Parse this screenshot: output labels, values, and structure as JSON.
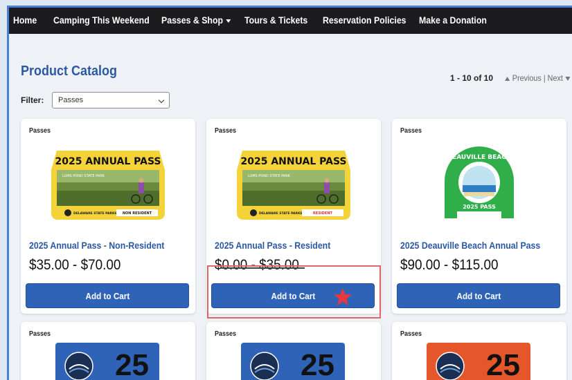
{
  "nav": {
    "items": [
      {
        "label": "Home"
      },
      {
        "label": "Camping This Weekend"
      },
      {
        "label": "Passes & Shop"
      },
      {
        "label": "Tours & Tickets"
      },
      {
        "label": "Reservation Policies"
      },
      {
        "label": "Make a Donation"
      }
    ]
  },
  "catalog": {
    "title": "Product Catalog",
    "pager": {
      "count": "1 - 10 of 10",
      "previous": "Previous",
      "separator": "|",
      "next": "Next"
    },
    "filter": {
      "label": "Filter:",
      "selected": "Passes"
    }
  },
  "products": [
    {
      "category": "Passes",
      "title": "2025 Annual Pass - Non-Resident",
      "price": "$35.00 - $70.00",
      "button": "Add to Cart",
      "pass": {
        "heading": "2025 ANNUAL PASS",
        "park": "LUMS POND STATE PARK",
        "brand": "DELAWARE STATE PARKS",
        "tag": "NON RESIDENT",
        "tag_color": "#222222"
      }
    },
    {
      "category": "Passes",
      "title": "2025 Annual Pass - Resident",
      "price": "$0.00 - $35.00",
      "button": "Add to Cart",
      "pass": {
        "heading": "2025 ANNUAL PASS",
        "park": "LUMS POND STATE PARK",
        "brand": "DELAWARE STATE PARKS",
        "tag": "RESIDENT",
        "tag_color": "#d6323c"
      }
    },
    {
      "category": "Passes",
      "title": "2025 Deauville Beach Annual Pass",
      "price": "$90.00 - $115.00",
      "button": "Add to Cart",
      "pass": {
        "heading": "DEAUVILLE BEACH",
        "label": "2025 PASS"
      }
    }
  ],
  "bottom_row": [
    {
      "category": "Passes",
      "number": "25",
      "color": "#2f63b8"
    },
    {
      "category": "Passes",
      "number": "25",
      "color": "#2f63b8"
    },
    {
      "category": "Passes",
      "number": "25",
      "color": "#e5572b"
    }
  ],
  "colors": {
    "accent": "#2f63b8",
    "link": "#2b58a3",
    "highlight": "#e26565",
    "star": "#e6383e",
    "pass_yellow": "#f3d23a",
    "beach_green": "#2fae4a"
  }
}
